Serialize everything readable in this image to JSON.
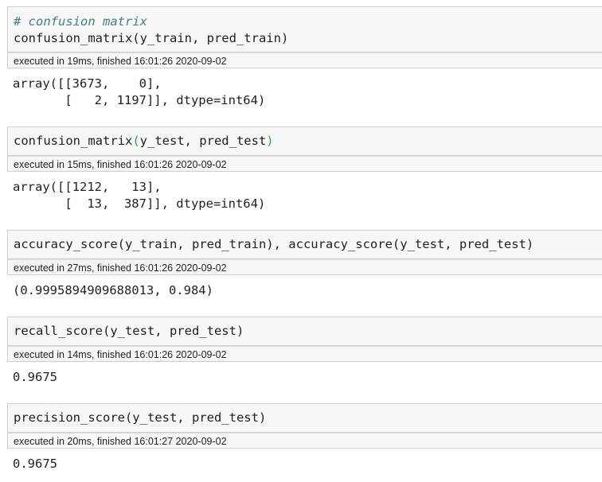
{
  "cells": [
    {
      "comment": "# confusion matrix",
      "code": "confusion_matrix(y_train, pred_train)",
      "exec": "executed in 19ms, finished 16:01:26 2020-09-02",
      "output": "array([[3673,    0],\n       [   2, 1197]], dtype=int64)"
    },
    {
      "code_main": "confusion_matrix",
      "code_paren_open": "(",
      "code_args": "y_test, pred_test",
      "code_paren_close": ")",
      "exec": "executed in 15ms, finished 16:01:26 2020-09-02",
      "output": "array([[1212,   13],\n       [  13,  387]], dtype=int64)"
    },
    {
      "code": "accuracy_score(y_train, pred_train), accuracy_score(y_test, pred_test)",
      "exec": "executed in 27ms, finished 16:01:26 2020-09-02",
      "output": "(0.9995894909688013, 0.984)"
    },
    {
      "code": "recall_score(y_test, pred_test)",
      "exec": "executed in 14ms, finished 16:01:26 2020-09-02",
      "output": "0.9675"
    },
    {
      "code": "precision_score(y_test, pred_test)",
      "exec": "executed in 20ms, finished 16:01:27 2020-09-02",
      "output": "0.9675"
    }
  ]
}
